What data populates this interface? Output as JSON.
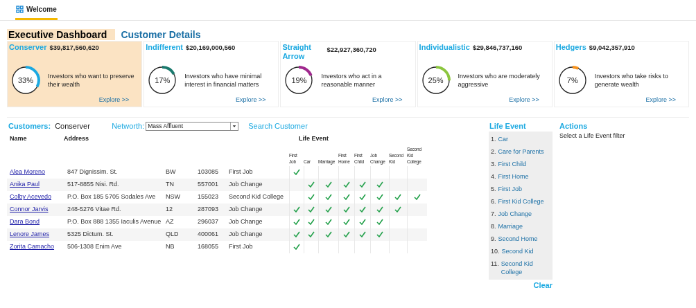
{
  "top_tabs": [
    {
      "label": "Welcome",
      "selected": true
    }
  ],
  "view_tabs": [
    {
      "label": "Executive Dashboard",
      "selected": true
    },
    {
      "label": "Customer Details",
      "selected": false
    }
  ],
  "segments": [
    {
      "name": "Conserver",
      "amount": "$39,817,560,620",
      "percent": "33%",
      "level": 0.33,
      "color": "#1ca9e1",
      "description": "Investors who want to preserve their wealth",
      "link": "Explore >>",
      "selected": true
    },
    {
      "name": "Indifferent",
      "amount": "$20,169,000,560",
      "percent": "17%",
      "level": 0.17,
      "color": "#1b7a6e",
      "description": "Investors who have minimal interest in financial matters",
      "link": "Explore >>",
      "selected": false
    },
    {
      "name": "Straight Arrow",
      "amount": "$22,927,360,720",
      "percent": "19%",
      "level": 0.19,
      "color": "#a0288e",
      "description": "Investors who act in a reasonable manner",
      "link": "Explore >>",
      "selected": false
    },
    {
      "name": "Individualistic",
      "amount": "$29,846,737,160",
      "percent": "25%",
      "level": 0.25,
      "color": "#8cc63f",
      "description": "Investors who are moderately aggressive",
      "link": "Explore >>",
      "selected": false
    },
    {
      "name": "Hedgers",
      "amount": "$9,042,357,910",
      "percent": "7%",
      "level": 0.07,
      "color": "#f7931e",
      "description": "Investors who take risks to generate wealth",
      "link": "Explore >>",
      "selected": false
    }
  ],
  "customers": {
    "label": "Customers:",
    "segment": "Conserver",
    "networth_label": "Networth:",
    "networth_value": "Mass Affluent",
    "search_link": "Search Customer",
    "columns": [
      "Name",
      "Address",
      "Life Event"
    ],
    "event_columns": [
      "First Job",
      "Car",
      "Marriage",
      "First Home",
      "First Child",
      "Job Change",
      "Second Kid",
      "Second Kid College"
    ],
    "rows": [
      {
        "name": "Alea Moreno",
        "address": "847 Dignissim. St.",
        "state": "BW",
        "zip": "103085",
        "life_event": "First Job",
        "events": [
          true,
          false,
          false,
          false,
          false,
          false,
          false,
          false
        ]
      },
      {
        "name": "Anika Paul",
        "address": "517-8855 Nisi. Rd.",
        "state": "TN",
        "zip": "557001",
        "life_event": "Job Change",
        "events": [
          false,
          true,
          true,
          true,
          true,
          true,
          false,
          false
        ]
      },
      {
        "name": "Colby Acevedo",
        "address": "P.O. Box 185 5705 Sodales Ave",
        "state": "NSW",
        "zip": "155023",
        "life_event": "Second Kid College",
        "events": [
          false,
          true,
          true,
          true,
          true,
          true,
          true,
          true
        ]
      },
      {
        "name": "Connor Jarvis",
        "address": "248-5276 Vitae Rd.",
        "state": "12",
        "zip": "287093",
        "life_event": "Job Change",
        "events": [
          true,
          true,
          true,
          true,
          true,
          true,
          true,
          false
        ]
      },
      {
        "name": "Dara Bond",
        "address": "P.O. Box 888 1355 Iaculis Avenue",
        "state": "AZ",
        "zip": "296037",
        "life_event": "Job Change",
        "events": [
          true,
          true,
          true,
          true,
          true,
          true,
          false,
          false
        ]
      },
      {
        "name": "Lenore James",
        "address": "5325 Dictum. St.",
        "state": "QLD",
        "zip": "400061",
        "life_event": "Job Change",
        "events": [
          true,
          true,
          true,
          true,
          true,
          true,
          false,
          false
        ]
      },
      {
        "name": "Zorita Camacho",
        "address": "506-1308 Enim Ave",
        "state": "NB",
        "zip": "168055",
        "life_event": "First Job",
        "events": [
          true,
          false,
          false,
          false,
          false,
          false,
          false,
          false
        ]
      }
    ]
  },
  "life_event_filter": {
    "title": "Life Event",
    "items": [
      {
        "number": "1.",
        "label": "Car"
      },
      {
        "number": "2.",
        "label": "Care for Parents"
      },
      {
        "number": "3.",
        "label": "First Child"
      },
      {
        "number": "4.",
        "label": "First Home"
      },
      {
        "number": "5.",
        "label": "First Job"
      },
      {
        "number": "6.",
        "label": "First Kid College"
      },
      {
        "number": "7.",
        "label": "Job Change"
      },
      {
        "number": "8.",
        "label": "Marriage"
      },
      {
        "number": "9.",
        "label": "Second Home"
      },
      {
        "number": "10.",
        "label": "Second Kid"
      },
      {
        "number": "11.",
        "label": "Second Kid College"
      }
    ],
    "clear": "Clear"
  },
  "actions": {
    "title": "Actions",
    "message": "Select a Life Event filter"
  }
}
